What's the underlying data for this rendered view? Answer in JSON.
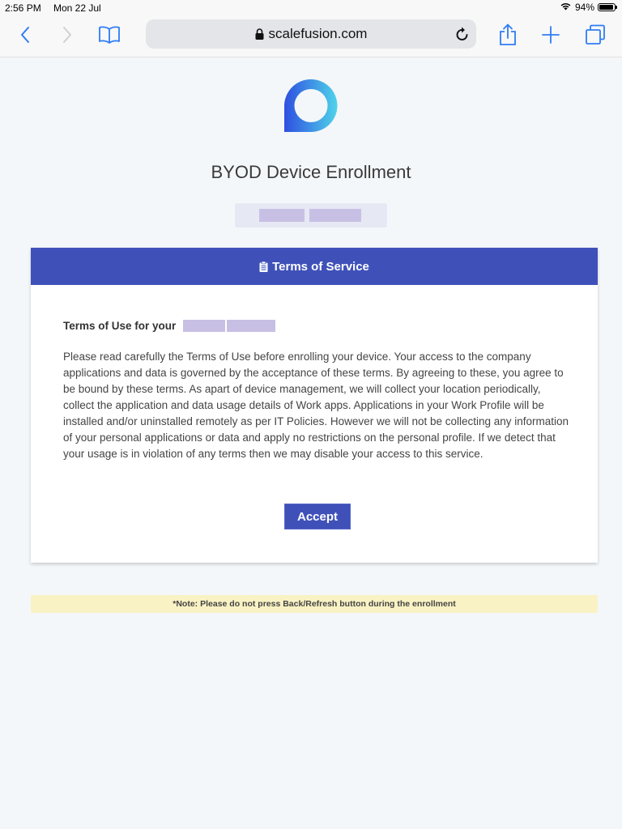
{
  "status_bar": {
    "time": "2:56 PM",
    "date": "Mon 22 Jul",
    "battery_percent": "94%",
    "battery_level": 0.94
  },
  "browser": {
    "url": "scalefusion.com",
    "icons": {
      "back": "chevron-left-icon",
      "forward": "chevron-right-icon",
      "bookmarks": "book-icon",
      "lock": "lock-icon",
      "reload": "reload-icon",
      "share": "share-icon",
      "new_tab": "plus-icon",
      "tabs": "tabs-icon"
    },
    "accent_color": "#2f7cf6"
  },
  "page": {
    "title": "BYOD Device Enrollment",
    "card": {
      "header": "Terms of Service",
      "header_icon": "clipboard-icon",
      "header_color": "#3f51b9",
      "tou_title": "Terms of Use for your",
      "body": "Please read carefully the Terms of Use before enrolling your device. Your access to the company applications and data is governed by the acceptance of these terms. By agreeing to these, you agree to be bound by these terms. As apart of device management, we will collect your location periodically, collect the application and data usage details of Work apps. Applications in your Work Profile will be installed and/or uninstalled remotely as per IT Policies. However we will not be collecting any information of your personal applications or data and apply no restrictions on the personal profile. If we detect that your usage is in violation of any terms then we may disable your access to this service.",
      "accept_label": "Accept"
    },
    "note": "*Note: Please do not press Back/Refresh button during the enrollment",
    "note_color": "#f9f2c4"
  }
}
